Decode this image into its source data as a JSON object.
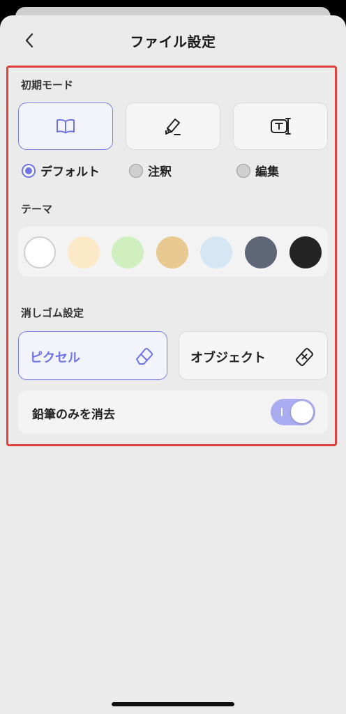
{
  "header": {
    "title": "ファイル設定",
    "back_icon": "chevron-left-icon"
  },
  "initial_mode": {
    "section_title": "初期モード",
    "modes": [
      {
        "label": "デフォルト",
        "icon": "book-open-icon",
        "selected": true
      },
      {
        "label": "注釈",
        "icon": "pencil-icon",
        "selected": false
      },
      {
        "label": "編集",
        "icon": "text-box-icon",
        "selected": false
      }
    ]
  },
  "theme": {
    "section_title": "テーマ",
    "colors": [
      "#ffffff",
      "#fbe9c8",
      "#cfefbe",
      "#e8c991",
      "#d5e6f5",
      "#5f6678",
      "#232323"
    ],
    "selected_index": 0
  },
  "eraser": {
    "section_title": "消しゴム設定",
    "options": [
      {
        "label": "ピクセル",
        "icon": "eraser-icon",
        "selected": true
      },
      {
        "label": "オブジェクト",
        "icon": "object-eraser-icon",
        "selected": false
      }
    ]
  },
  "pencil_only": {
    "label": "鉛筆のみを消去",
    "enabled": true
  },
  "colors": {
    "accent": "#6e73e3",
    "toggle_on": "#a9acf0",
    "highlight_border": "#e0403c",
    "sheet_bg": "#ebebeb"
  }
}
